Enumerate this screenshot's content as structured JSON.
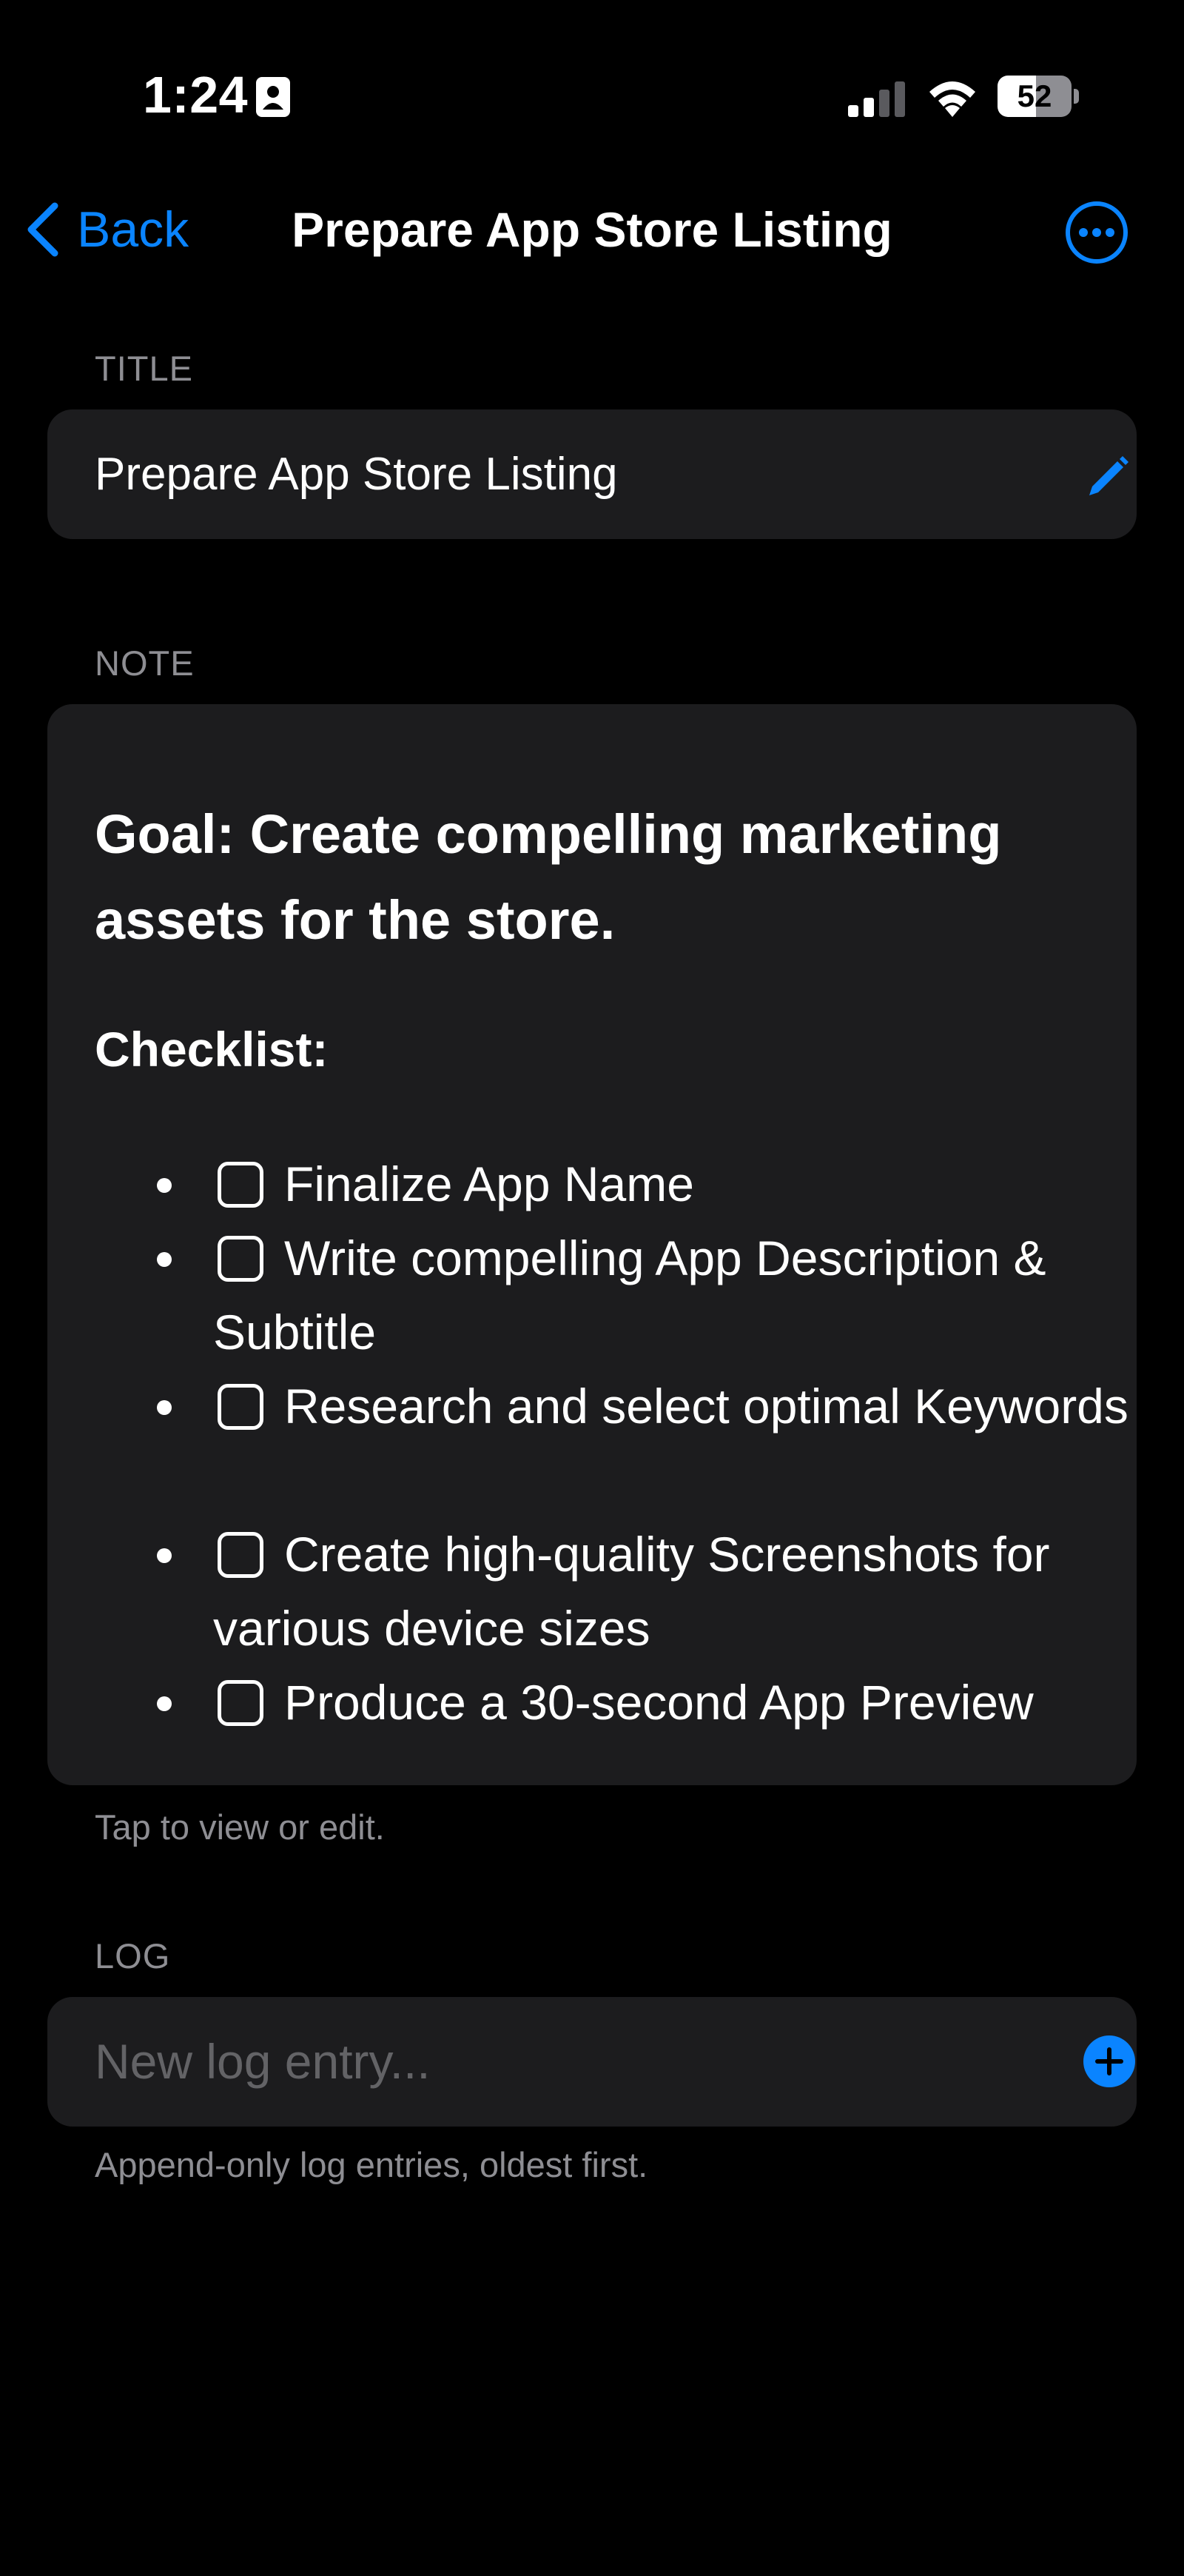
{
  "status_bar": {
    "time": "1:24",
    "battery_percent": "52",
    "battery_level": 0.52
  },
  "nav": {
    "back_label": "Back",
    "title": "Prepare App Store Listing"
  },
  "title_section": {
    "header": "TITLE",
    "value": "Prepare App Store Listing"
  },
  "note_section": {
    "header": "NOTE",
    "goal": "Goal: Create compelling marketing assets for the store.",
    "checklist_heading": "Checklist:",
    "items": [
      {
        "text": "Finalize App Name",
        "checked": false
      },
      {
        "text": "Write compelling App Description & Subtitle",
        "checked": false
      },
      {
        "text": "Research and select optimal Keywords",
        "checked": false
      },
      {
        "text": "Create high-quality Screenshots for various device sizes",
        "checked": false
      },
      {
        "text": "Produce a 30-second App Preview",
        "checked": false
      }
    ],
    "footer": "Tap to view or edit."
  },
  "log_section": {
    "header": "LOG",
    "placeholder": "New log entry...",
    "footer": "Append-only log entries, oldest first."
  },
  "colors": {
    "accent": "#0a84ff",
    "background": "#000000",
    "card": "#1c1c1e",
    "secondary_text": "#8e8e93"
  }
}
